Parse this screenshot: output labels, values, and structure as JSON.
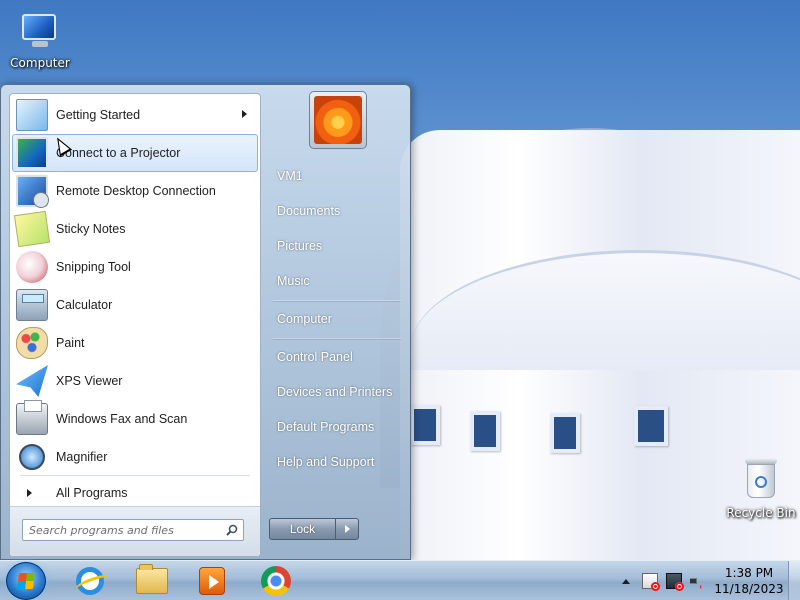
{
  "desktop": {
    "icons": [
      {
        "label": "Computer",
        "icon": "computer-icon"
      },
      {
        "label": "Recycle Bin",
        "icon": "recycle-bin-icon"
      }
    ]
  },
  "start_menu": {
    "programs": [
      {
        "label": "Getting Started",
        "icon": "getting-started-icon",
        "has_submenu": true
      },
      {
        "label": "Connect to a Projector",
        "icon": "projector-icon",
        "selected": true
      },
      {
        "label": "Remote Desktop Connection",
        "icon": "remote-desktop-icon"
      },
      {
        "label": "Sticky Notes",
        "icon": "sticky-notes-icon"
      },
      {
        "label": "Snipping Tool",
        "icon": "snipping-tool-icon"
      },
      {
        "label": "Calculator",
        "icon": "calculator-icon"
      },
      {
        "label": "Paint",
        "icon": "paint-icon"
      },
      {
        "label": "XPS Viewer",
        "icon": "xps-viewer-icon"
      },
      {
        "label": "Windows Fax and Scan",
        "icon": "fax-scan-icon"
      },
      {
        "label": "Magnifier",
        "icon": "magnifier-icon"
      }
    ],
    "all_programs_label": "All Programs",
    "search_placeholder": "Search programs and files",
    "right_links": [
      "VM1",
      "Documents",
      "Pictures",
      "Music",
      "Computer",
      "Control Panel",
      "Devices and Printers",
      "Default Programs",
      "Help and Support"
    ],
    "lock_label": "Lock"
  },
  "taskbar": {
    "apps": [
      {
        "name": "Internet Explorer",
        "icon": "internet-explorer-icon"
      },
      {
        "name": "Windows Explorer",
        "icon": "folder-icon"
      },
      {
        "name": "Windows Media Player",
        "icon": "media-player-icon"
      },
      {
        "name": "Google Chrome",
        "icon": "chrome-icon"
      }
    ],
    "clock": {
      "time": "1:38 PM",
      "date": "11/18/2023"
    }
  },
  "colors": {
    "accent": "#2a7bd0",
    "selection": "#d3e5fa",
    "alert": "#ee1111"
  }
}
